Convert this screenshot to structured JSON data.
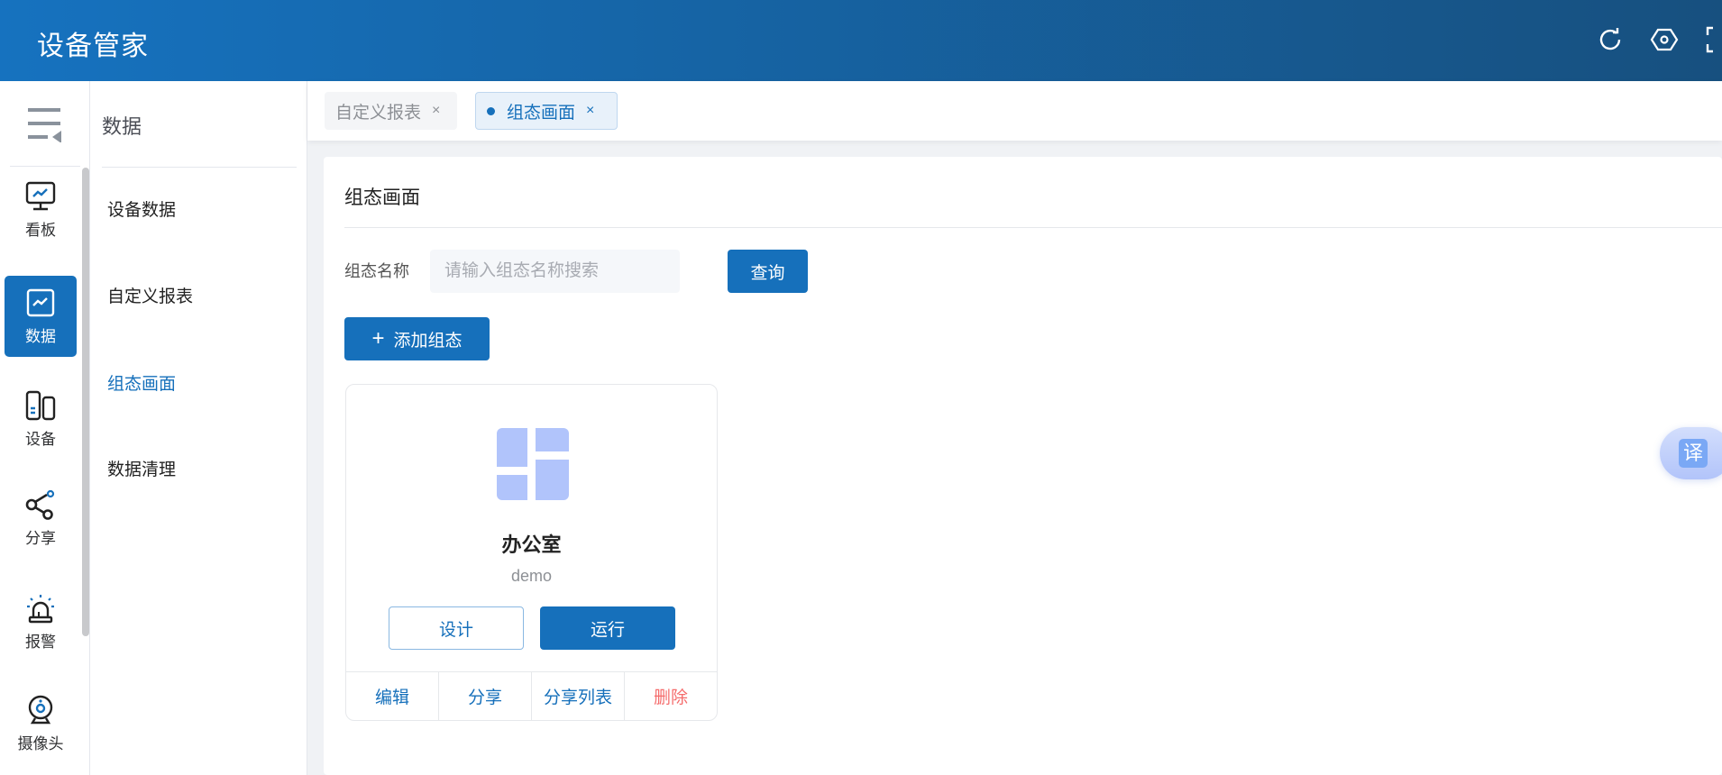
{
  "header": {
    "title": "设备管家",
    "icons": [
      "refresh-icon",
      "settings-icon",
      "fullscreen-icon"
    ]
  },
  "rail": {
    "items": [
      {
        "label": "看板",
        "icon": "dashboard-icon"
      },
      {
        "label": "数据",
        "icon": "data-icon",
        "active": true
      },
      {
        "label": "设备",
        "icon": "device-icon"
      },
      {
        "label": "分享",
        "icon": "share-icon"
      },
      {
        "label": "报警",
        "icon": "alarm-icon"
      },
      {
        "label": "摄像头",
        "icon": "camera-icon"
      }
    ]
  },
  "submenu": {
    "title": "数据",
    "items": [
      {
        "label": "设备数据"
      },
      {
        "label": "自定义报表"
      },
      {
        "label": "组态画面",
        "active": true
      },
      {
        "label": "数据清理"
      }
    ]
  },
  "tabs": [
    {
      "label": "自定义报表",
      "close": "×"
    },
    {
      "label": "组态画面",
      "close": "×",
      "active": true
    }
  ],
  "main": {
    "title": "组态画面",
    "form_label": "组态名称",
    "search_placeholder": "请输入组态名称搜索",
    "search_value": "",
    "query_label": "查询",
    "add_label": "添加组态",
    "add_icon": "+",
    "cards": [
      {
        "name": "办公室",
        "desc": "demo",
        "design_label": "设计",
        "run_label": "运行",
        "actions": [
          "编辑",
          "分享",
          "分享列表",
          "删除"
        ]
      }
    ]
  },
  "translate": {
    "label": "译"
  },
  "colors": {
    "primary": "#1670bb",
    "danger": "#f56c6c",
    "header_start": "#1672bf",
    "header_end": "#17507f"
  }
}
